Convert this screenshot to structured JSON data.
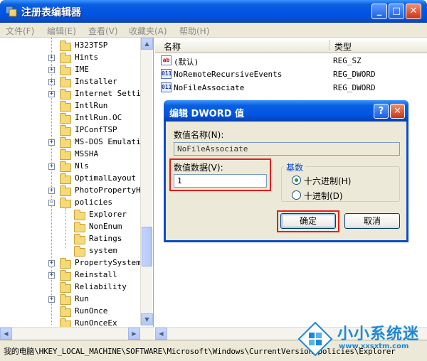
{
  "window": {
    "title": "注册表编辑器",
    "min": "_",
    "max": "□",
    "close": "✕"
  },
  "menu": [
    "文件(F)",
    "编辑(E)",
    "查看(V)",
    "收藏夹(A)",
    "帮助(H)"
  ],
  "tree": {
    "items": [
      {
        "label": "H323TSP",
        "expander": ""
      },
      {
        "label": "Hints",
        "expander": "+"
      },
      {
        "label": "IME",
        "expander": "+"
      },
      {
        "label": "Installer",
        "expander": "+"
      },
      {
        "label": "Internet Setti",
        "expander": "+"
      },
      {
        "label": "IntlRun",
        "expander": ""
      },
      {
        "label": "IntlRun.OC",
        "expander": ""
      },
      {
        "label": "IPConfTSP",
        "expander": ""
      },
      {
        "label": "MS-DOS Emulati",
        "expander": "+"
      },
      {
        "label": "MSSHA",
        "expander": ""
      },
      {
        "label": "Nls",
        "expander": "+"
      },
      {
        "label": "OptimalLayout",
        "expander": ""
      },
      {
        "label": "PhotoPropertyH",
        "expander": "+"
      },
      {
        "label": "policies",
        "expander": "−"
      },
      {
        "label": "Explorer",
        "expander": ""
      },
      {
        "label": "NonEnum",
        "expander": ""
      },
      {
        "label": "Ratings",
        "expander": ""
      },
      {
        "label": "system",
        "expander": ""
      },
      {
        "label": "PropertySystem",
        "expander": "+"
      },
      {
        "label": "Reinstall",
        "expander": "+"
      },
      {
        "label": "Reliability",
        "expander": ""
      },
      {
        "label": "Run",
        "expander": "+"
      },
      {
        "label": "RunOnce",
        "expander": ""
      },
      {
        "label": "RunOnceEx",
        "expander": ""
      }
    ]
  },
  "list": {
    "col_name": "名称",
    "col_type": "类型",
    "rows": [
      {
        "icon": "ab",
        "name": "(默认)",
        "type": "REG_SZ"
      },
      {
        "icon": "011",
        "name": "NoRemoteRecursiveEvents",
        "type": "REG_DWORD"
      },
      {
        "icon": "011",
        "name": "NoFileAssociate",
        "type": "REG_DWORD"
      }
    ]
  },
  "dialog": {
    "title": "编辑 DWORD 值",
    "help": "?",
    "close": "✕",
    "value_name_label": "数值名称(N):",
    "value_name": "NoFileAssociate",
    "value_data_label": "数值数据(V):",
    "value_data": "1",
    "base_label": "基数",
    "hex_label": "十六进制(H)",
    "dec_label": "十进制(D)",
    "ok": "确定",
    "cancel": "取消"
  },
  "statusbar": {
    "path": "我的电脑\\HKEY_LOCAL_MACHINE\\SOFTWARE\\Microsoft\\Windows\\CurrentVersion\\policies\\Explorer"
  },
  "watermark": {
    "text": "小小系统迷",
    "url": "www.xxsxtm.com"
  },
  "colors": {
    "titlebar": "#0054e3",
    "highlight_box": "#e0201c",
    "watermark": "#1e88d8"
  }
}
